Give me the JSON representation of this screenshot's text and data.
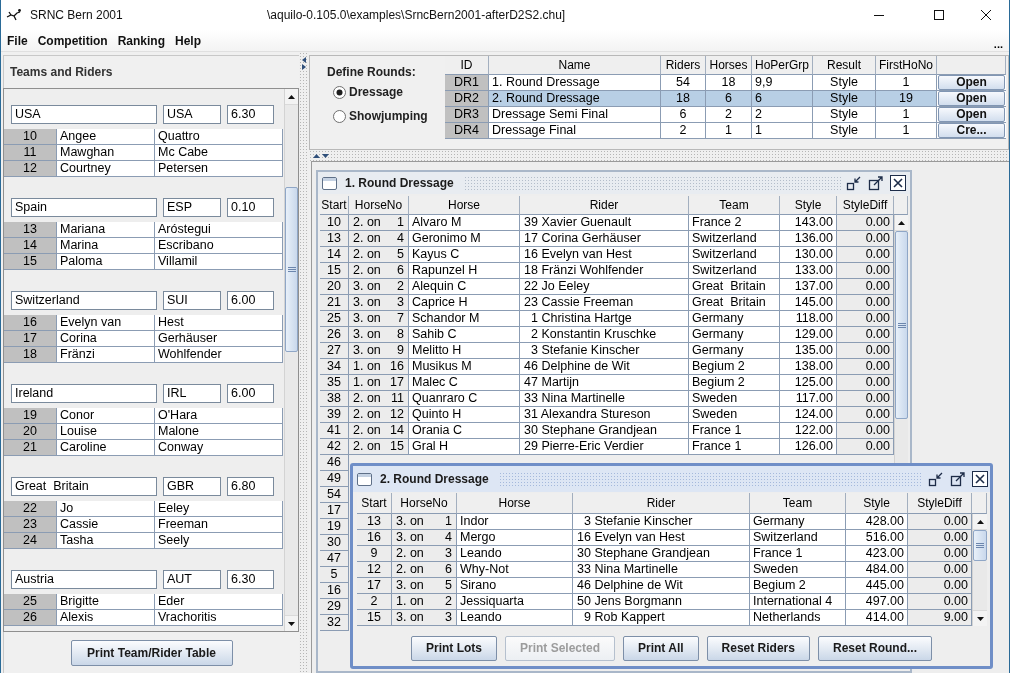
{
  "window": {
    "title": "SRNC Bern 2001",
    "file_path": "\\aquilo-0.105.0\\examples\\SrncBern2001-afterD2S2.chu]"
  },
  "menu": [
    "File",
    "Competition",
    "Ranking",
    "Help"
  ],
  "menu_overflow": "...",
  "teams_panel": {
    "title": "Teams and Riders",
    "teams": [
      {
        "name": "USA",
        "code": "USA",
        "value": "6.30",
        "riders": [
          {
            "number": "10",
            "first_name": "Angee",
            "last_name": "Quattro"
          },
          {
            "number": "11",
            "first_name": "Mawghan",
            "last_name": "Mc Cabe"
          },
          {
            "number": "12",
            "first_name": "Courtney",
            "last_name": "Petersen"
          }
        ]
      },
      {
        "name": "Spain",
        "code": "ESP",
        "value": "0.10",
        "riders": [
          {
            "number": "13",
            "first_name": "Mariana",
            "last_name": "Aróstegui"
          },
          {
            "number": "14",
            "first_name": "Marina",
            "last_name": "Escribano"
          },
          {
            "number": "15",
            "first_name": "Paloma",
            "last_name": "Villamil"
          }
        ]
      },
      {
        "name": "Switzerland",
        "code": "SUI",
        "value": "6.00",
        "riders": [
          {
            "number": "16",
            "first_name": "Evelyn van",
            "last_name": "Hest"
          },
          {
            "number": "17",
            "first_name": "Corina",
            "last_name": "Gerhäuser"
          },
          {
            "number": "18",
            "first_name": "Fränzi",
            "last_name": "Wohlfender"
          }
        ]
      },
      {
        "name": "Ireland",
        "code": "IRL",
        "value": "6.00",
        "riders": [
          {
            "number": "19",
            "first_name": "Conor",
            "last_name": "O'Hara"
          },
          {
            "number": "20",
            "first_name": "Louise",
            "last_name": "Malone"
          },
          {
            "number": "21",
            "first_name": "Caroline",
            "last_name": "Conway"
          }
        ]
      },
      {
        "name": "Great  Britain",
        "code": "GBR",
        "value": "6.80",
        "riders": [
          {
            "number": "22",
            "first_name": "Jo",
            "last_name": "Eeley"
          },
          {
            "number": "23",
            "first_name": "Cassie",
            "last_name": "Freeman"
          },
          {
            "number": "24",
            "first_name": "Tasha",
            "last_name": "Seely"
          }
        ]
      },
      {
        "name": "Austria",
        "code": "AUT",
        "value": "6.30",
        "riders": [
          {
            "number": "25",
            "first_name": "Brigitte",
            "last_name": "Eder"
          },
          {
            "number": "26",
            "first_name": "Alexis",
            "last_name": "Vrachoritis"
          }
        ]
      }
    ],
    "print_button": "Print Team/Rider Table"
  },
  "define_rounds": {
    "label": "Define Rounds:",
    "disciplines": [
      {
        "label": "Dressage",
        "selected": true
      },
      {
        "label": "Showjumping",
        "selected": false
      }
    ]
  },
  "rounds_table": {
    "columns": [
      "ID",
      "Name",
      "Riders",
      "Horses",
      "HoPerGrp",
      "Result",
      "FirstHoNo"
    ],
    "rows": [
      {
        "id": "DR1",
        "name": "1. Round Dressage",
        "riders": "54",
        "horses": "18",
        "ho_per_grp": "9,9",
        "result": "Style",
        "first_ho_no": "1",
        "action": "Open",
        "selected": false
      },
      {
        "id": "DR2",
        "name": "2. Round Dressage",
        "riders": "18",
        "horses": "6",
        "ho_per_grp": "6",
        "result": "Style",
        "first_ho_no": "19",
        "action": "Open",
        "selected": true
      },
      {
        "id": "DR3",
        "name": "Dressage Semi Final",
        "riders": "6",
        "horses": "2",
        "ho_per_grp": "2",
        "result": "Style",
        "first_ho_no": "1",
        "action": "Open",
        "selected": false
      },
      {
        "id": "DR4",
        "name": "Dressage Final",
        "riders": "2",
        "horses": "1",
        "ho_per_grp": "1",
        "result": "Style",
        "first_ho_no": "1",
        "action": "Cre...",
        "selected": false
      }
    ]
  },
  "round_windows": [
    {
      "title": "1. Round Dressage",
      "active": false,
      "columns": [
        "Start",
        "HorseNo",
        "Horse",
        "Rider",
        "Team",
        "Style",
        "StyleDiff"
      ],
      "rows": [
        {
          "start": "10",
          "horse_group": "2. on",
          "horse_no": "1",
          "horse": "Alvaro M",
          "rider_no": "39",
          "rider": "Xavier Guenault",
          "team": "France 2",
          "style": "143.00",
          "style_diff": "0.00"
        },
        {
          "start": "13",
          "horse_group": "2. on",
          "horse_no": "4",
          "horse": "Geronimo M",
          "rider_no": "17",
          "rider": "Corina Gerhäuser",
          "team": "Switzerland",
          "style": "136.00",
          "style_diff": "0.00"
        },
        {
          "start": "14",
          "horse_group": "2. on",
          "horse_no": "5",
          "horse": "Kayus C",
          "rider_no": "16",
          "rider": "Evelyn van Hest",
          "team": "Switzerland",
          "style": "130.00",
          "style_diff": "0.00"
        },
        {
          "start": "15",
          "horse_group": "2. on",
          "horse_no": "6",
          "horse": "Rapunzel H",
          "rider_no": "18",
          "rider": "Fränzi Wohlfender",
          "team": "Switzerland",
          "style": "133.00",
          "style_diff": "0.00"
        },
        {
          "start": "20",
          "horse_group": "3. on",
          "horse_no": "2",
          "horse": "Alequin C",
          "rider_no": "22",
          "rider": "Jo Eeley",
          "team": "Great  Britain",
          "style": "137.00",
          "style_diff": "0.00"
        },
        {
          "start": "21",
          "horse_group": "3. on",
          "horse_no": "3",
          "horse": "Caprice H",
          "rider_no": "23",
          "rider": "Cassie Freeman",
          "team": "Great  Britain",
          "style": "145.00",
          "style_diff": "0.00"
        },
        {
          "start": "25",
          "horse_group": "3. on",
          "horse_no": "7",
          "horse": "Schandor M",
          "rider_no": "1",
          "rider": "Christina Hartge",
          "team": "Germany",
          "style": "118.00",
          "style_diff": "0.00"
        },
        {
          "start": "26",
          "horse_group": "3. on",
          "horse_no": "8",
          "horse": "Sahib C",
          "rider_no": "2",
          "rider": "Konstantin Kruschke",
          "team": "Germany",
          "style": "129.00",
          "style_diff": "0.00"
        },
        {
          "start": "27",
          "horse_group": "3. on",
          "horse_no": "9",
          "horse": "Melitto H",
          "rider_no": "3",
          "rider": "Stefanie Kinscher",
          "team": "Germany",
          "style": "135.00",
          "style_diff": "0.00"
        },
        {
          "start": "34",
          "horse_group": "1. on",
          "horse_no": "16",
          "horse": "Musikus M",
          "rider_no": "46",
          "rider": "Delphine de Wit",
          "team": "Begium 2",
          "style": "138.00",
          "style_diff": "0.00"
        },
        {
          "start": "35",
          "horse_group": "1. on",
          "horse_no": "17",
          "horse": "Malec C",
          "rider_no": "47",
          "rider": "Martijn",
          "team": "Begium 2",
          "style": "125.00",
          "style_diff": "0.00"
        },
        {
          "start": "38",
          "horse_group": "2. on",
          "horse_no": "11",
          "horse": "Quanraro C",
          "rider_no": "33",
          "rider": "Nina Martinelle",
          "team": "Sweden",
          "style": "117.00",
          "style_diff": "0.00"
        },
        {
          "start": "39",
          "horse_group": "2. on",
          "horse_no": "12",
          "horse": "Quinto H",
          "rider_no": "31",
          "rider": "Alexandra Stureson",
          "team": "Sweden",
          "style": "124.00",
          "style_diff": "0.00"
        },
        {
          "start": "41",
          "horse_group": "2. on",
          "horse_no": "14",
          "horse": "Orania C",
          "rider_no": "30",
          "rider": "Stephane Grandjean",
          "team": "France 1",
          "style": "122.00",
          "style_diff": "0.00"
        },
        {
          "start": "42",
          "horse_group": "2. on",
          "horse_no": "15",
          "horse": "Gral H",
          "rider_no": "29",
          "rider": "Pierre-Eric Verdier",
          "team": "France 1",
          "style": "126.00",
          "style_diff": "0.00"
        },
        {
          "start": "46"
        },
        {
          "start": "49"
        },
        {
          "start": "54"
        },
        {
          "start": "17"
        },
        {
          "start": "19"
        },
        {
          "start": "30"
        },
        {
          "start": "47"
        },
        {
          "start": "5"
        },
        {
          "start": "16"
        },
        {
          "start": "29"
        },
        {
          "start": "32"
        }
      ]
    },
    {
      "title": "2. Round Dressage",
      "active": true,
      "columns": [
        "Start",
        "HorseNo",
        "Horse",
        "Rider",
        "Team",
        "Style",
        "StyleDiff"
      ],
      "rows": [
        {
          "start": "13",
          "horse_group": "3. on",
          "horse_no": "1",
          "horse": "Indor",
          "rider_no": "3",
          "rider": "Stefanie Kinscher",
          "team": "Germany",
          "style": "428.00",
          "style_diff": "0.00"
        },
        {
          "start": "16",
          "horse_group": "3. on",
          "horse_no": "4",
          "horse": "Mergo",
          "rider_no": "16",
          "rider": "Evelyn van Hest",
          "team": "Switzerland",
          "style": "516.00",
          "style_diff": "0.00"
        },
        {
          "start": "9",
          "horse_group": "2. on",
          "horse_no": "3",
          "horse": "Leando",
          "rider_no": "30",
          "rider": "Stephane Grandjean",
          "team": "France 1",
          "style": "423.00",
          "style_diff": "0.00"
        },
        {
          "start": "12",
          "horse_group": "2. on",
          "horse_no": "6",
          "horse": "Why-Not",
          "rider_no": "33",
          "rider": "Nina Martinelle",
          "team": "Sweden",
          "style": "484.00",
          "style_diff": "0.00"
        },
        {
          "start": "17",
          "horse_group": "3. on",
          "horse_no": "5",
          "horse": "Sirano",
          "rider_no": "46",
          "rider": "Delphine de Wit",
          "team": "Begium 2",
          "style": "445.00",
          "style_diff": "0.00"
        },
        {
          "start": "2",
          "horse_group": "1. on",
          "horse_no": "2",
          "horse": "Jessiquarta",
          "rider_no": "50",
          "rider": "Jens Borgmann",
          "team": "International 4",
          "style": "497.00",
          "style_diff": "0.00"
        },
        {
          "start": "15",
          "horse_group": "3. on",
          "horse_no": "3",
          "horse": "Leando",
          "rider_no": "9",
          "rider": "Rob Kappert",
          "team": "Netherlands",
          "style": "414.00",
          "style_diff": "9.00"
        }
      ],
      "buttons": [
        {
          "label": "Print Lots",
          "disabled": false
        },
        {
          "label": "Print Selected",
          "disabled": true
        },
        {
          "label": "Print All",
          "disabled": false
        },
        {
          "label": "Reset Riders",
          "disabled": false
        },
        {
          "label": "Reset Round...",
          "disabled": false
        }
      ]
    }
  ]
}
